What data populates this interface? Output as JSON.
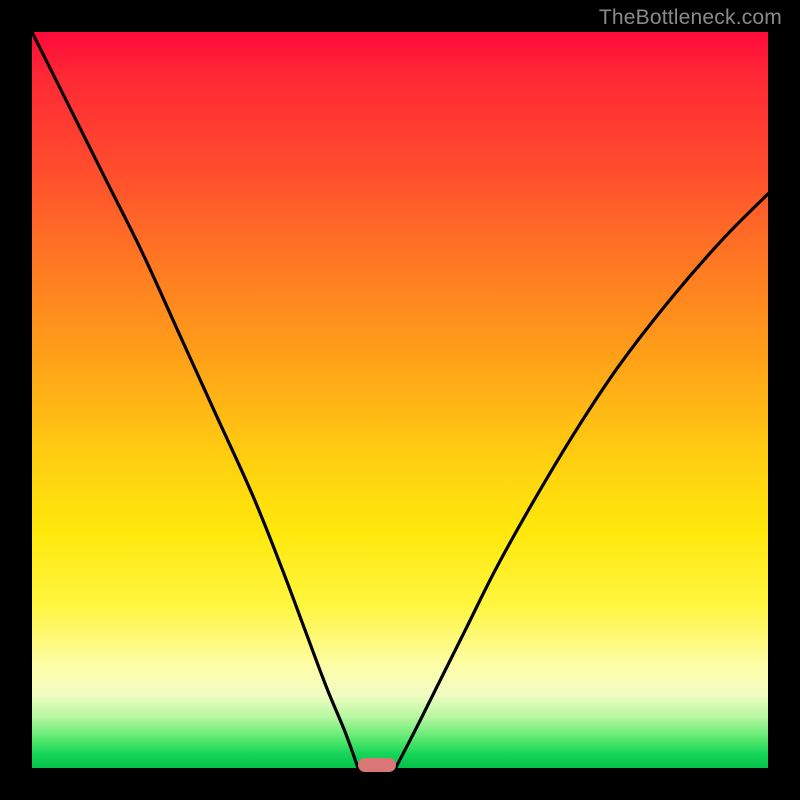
{
  "watermark": {
    "text": "TheBottleneck.com"
  },
  "chart_data": {
    "type": "line",
    "title": "",
    "xlabel": "",
    "ylabel": "",
    "xlim": [
      0,
      100
    ],
    "ylim": [
      0,
      100
    ],
    "grid": false,
    "legend": false,
    "background_gradient": {
      "direction": "vertical",
      "stops": [
        {
          "pos": 0,
          "color": "#ff0a3a"
        },
        {
          "pos": 18,
          "color": "#ff4b2e"
        },
        {
          "pos": 45,
          "color": "#ffa318"
        },
        {
          "pos": 68,
          "color": "#ffe80c"
        },
        {
          "pos": 86,
          "color": "#fdfda6"
        },
        {
          "pos": 96,
          "color": "#5ae96f"
        },
        {
          "pos": 100,
          "color": "#05c24a"
        }
      ]
    },
    "series": [
      {
        "name": "left-curve",
        "x": [
          0,
          5,
          10,
          15,
          20,
          25,
          30,
          34,
          37,
          40,
          42.5,
          44.3
        ],
        "y": [
          100,
          90,
          80,
          70,
          59,
          48,
          37,
          27,
          19,
          11,
          5,
          0
        ]
      },
      {
        "name": "right-curve",
        "x": [
          49.4,
          52,
          55,
          59,
          63,
          68,
          74,
          80,
          87,
          94,
          100
        ],
        "y": [
          0,
          5,
          11,
          19,
          27,
          36,
          46,
          55,
          64,
          72,
          78
        ]
      }
    ],
    "marker": {
      "name": "bottleneck-marker",
      "x_start": 44.3,
      "x_end": 49.4,
      "y": 0,
      "color": "#d97777"
    }
  }
}
